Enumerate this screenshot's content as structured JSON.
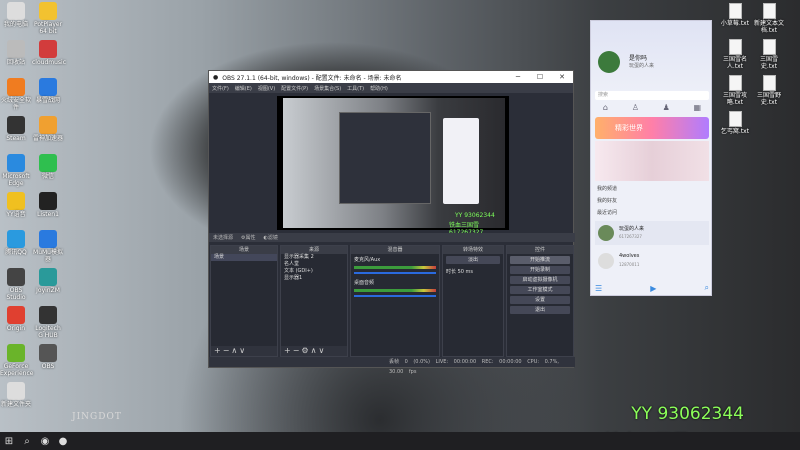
{
  "desktop_left": [
    {
      "label": "我的电脑"
    },
    {
      "label": "PotPlayer 64 bit"
    },
    {
      "label": "回收站"
    },
    {
      "label": "cloudmusic"
    },
    {
      "label": "火绒安全软件"
    },
    {
      "label": "暴雪战网"
    },
    {
      "label": "Steam"
    },
    {
      "label": "雷神加速器"
    },
    {
      "label": "Microsoft Edge"
    },
    {
      "label": "微信"
    },
    {
      "label": "YY语音"
    },
    {
      "label": "Listen1"
    },
    {
      "label": "腾讯QQ"
    },
    {
      "label": "MuMu模拟器"
    },
    {
      "label": "OBS Studio"
    },
    {
      "label": "JoyinZM"
    },
    {
      "label": "Origin"
    },
    {
      "label": "Logitech G HUB"
    },
    {
      "label": "GeForce Experience"
    },
    {
      "label": "OBS"
    },
    {
      "label": "新建文件夹"
    }
  ],
  "desktop_right": [
    {
      "label": "小草莓.txt"
    },
    {
      "label": "新建文本文档.txt"
    },
    {
      "label": "三国雪名人.txt"
    },
    {
      "label": "三国雪史.txt"
    },
    {
      "label": "三国雪攻略.txt"
    },
    {
      "label": "三国雪野史.txt"
    },
    {
      "label": "乞丐窝.txt"
    }
  ],
  "background": {
    "watermark": "JINGDOT",
    "overlay_line1": "YY 93062344",
    "overlay_line2": "铁血三国雪 617267327"
  },
  "obs": {
    "title": "OBS 27.1.1 (64-bit, windows) - 配置文件: 未命名 - 场景: 未命名",
    "menu": [
      "文件(F)",
      "编辑(E)",
      "视图(V)",
      "配置文件(P)",
      "场景集合(S)",
      "工具(T)",
      "帮助(H)"
    ],
    "preview_yy": "YY 93062344",
    "preview_yy2": "铁血三国雪 617267327",
    "tabs": [
      "未选择源",
      "属性",
      "滤镜"
    ],
    "docks": {
      "scenes": {
        "title": "场景",
        "items": [
          "场景"
        ]
      },
      "sources": {
        "title": "来源",
        "items": [
          "显示器采集 2",
          "名人堂",
          "文本 (GDI+)",
          "显示器1"
        ]
      },
      "mixer": {
        "title": "混音器",
        "channels": [
          {
            "name": "麦克风/Aux",
            "db": "0.0 dB"
          },
          {
            "name": "桌面音频",
            "db": "0.0 dB"
          }
        ]
      },
      "transitions": {
        "title": "转场特效",
        "type": "淡出",
        "duration_label": "时长",
        "duration": "50 ms"
      },
      "controls": {
        "title": "控件",
        "buttons": [
          "开始推流",
          "开始录制",
          "启动虚拟摄像机",
          "工作室模式",
          "设置",
          "退出"
        ]
      }
    },
    "status": {
      "drop": "丢帧 0 (0.0%)",
      "live": "LIVE: 00:00:00",
      "rec": "REC: 00:00:00",
      "cpu": "CPU: 0.7%, 30.00 fps"
    }
  },
  "qq": {
    "name": "是你吗",
    "signature": "玩蛋的人来",
    "search_placeholder": "搜索",
    "banner_text": "精彩世界",
    "groups": [
      "我的频道",
      "我的好友",
      "最近访问"
    ],
    "contacts": [
      {
        "name": "玩蛋的人来",
        "id": "617267327"
      },
      {
        "name": "4wolves",
        "id": "12870011"
      }
    ]
  },
  "taskbar": {
    "icons": [
      "windows-icon",
      "search-icon",
      "edge-icon",
      "obs-icon"
    ]
  }
}
